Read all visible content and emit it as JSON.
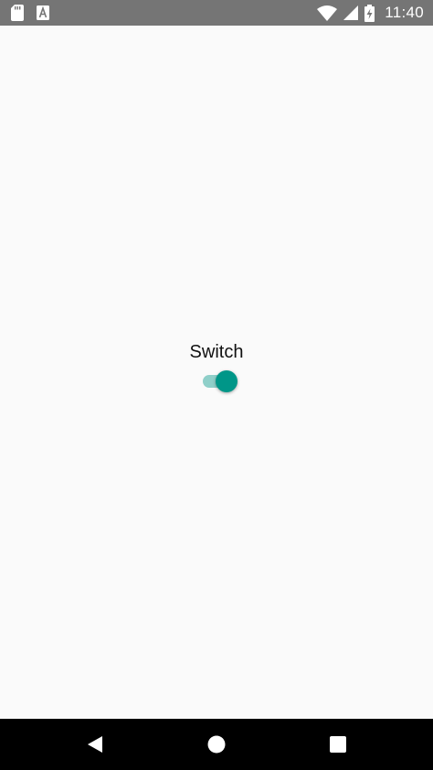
{
  "status_bar": {
    "time": "11:40",
    "left_icons": [
      "sd-card-icon",
      "font-a-icon"
    ],
    "right_icons": [
      "wifi-icon",
      "cell-signal-icon",
      "battery-charging-icon"
    ],
    "background": "#757575"
  },
  "main": {
    "switch_label": "Switch",
    "switch_state": "on",
    "accent_color": "#009688",
    "track_color": "#8fcfc9"
  },
  "nav_bar": {
    "buttons": [
      "back-icon",
      "home-icon",
      "recents-icon"
    ]
  }
}
